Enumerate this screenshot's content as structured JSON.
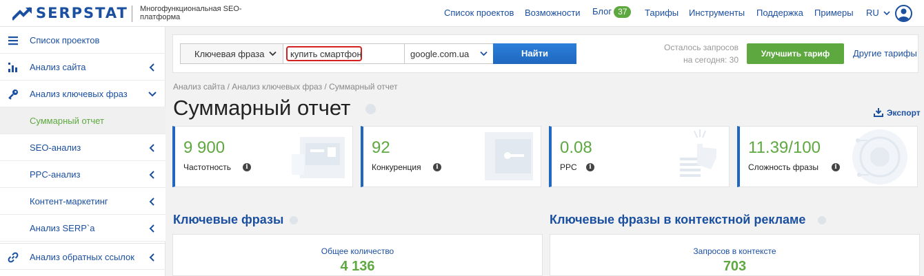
{
  "header": {
    "brand": "SERPSTAT",
    "tagline": "Многофункциональная SEO-платформа",
    "nav": [
      {
        "label": "Список проектов"
      },
      {
        "label": "Возможности"
      },
      {
        "label": "Блог",
        "badge": "37"
      },
      {
        "label": "Тарифы"
      },
      {
        "label": "Инструменты"
      },
      {
        "label": "Поддержка"
      },
      {
        "label": "Примеры"
      }
    ],
    "language": "RU"
  },
  "sidebar": {
    "items": [
      {
        "label": "Список проектов",
        "icon": "menu-icon"
      },
      {
        "label": "Анализ сайта",
        "icon": "site-analysis-icon"
      },
      {
        "label": "Анализ ключевых фраз",
        "icon": "key-icon"
      },
      {
        "label": "Суммарный отчет"
      },
      {
        "label": "SEO-анализ"
      },
      {
        "label": "PPC-анализ"
      },
      {
        "label": "Контент-маркетинг"
      },
      {
        "label": "Анализ SERP`a"
      },
      {
        "label": "Анализ обратных ссылок",
        "icon": "link-icon"
      }
    ]
  },
  "search": {
    "type_label": "Ключевая фраза",
    "query": "купить смартфон",
    "database": "google.com.ua",
    "find_label": "Найти",
    "requests_left_line1": "Осталось запросов",
    "requests_left_line2": "на сегодня: 30",
    "upgrade_label": "Улучшить тариф",
    "other_tariffs_label": "Другие тарифы"
  },
  "breadcrumb": "Анализ сайта / Анализ ключевых фраз / Суммарный отчет",
  "page_title": "Суммарный отчет",
  "export_label": "Экспорт",
  "cards": [
    {
      "value": "9 900",
      "label": "Частотность"
    },
    {
      "value": "92",
      "label": "Конкуренция"
    },
    {
      "value": "0.08",
      "label": "PPC"
    },
    {
      "value": "11.39/100",
      "label": "Сложность фразы"
    }
  ],
  "sections": [
    {
      "title": "Ключевые фразы",
      "metric_label": "Общее количество",
      "metric_value": "4 136"
    },
    {
      "title": "Ключевые фразы в контекстной рекламе",
      "metric_label": "Запросов в контексте",
      "metric_value": "703"
    }
  ],
  "colors": {
    "brand_blue": "#1b4fa0",
    "accent_green": "#5ea840",
    "button_blue": "#1f67bf",
    "highlight_red": "#d32020"
  }
}
